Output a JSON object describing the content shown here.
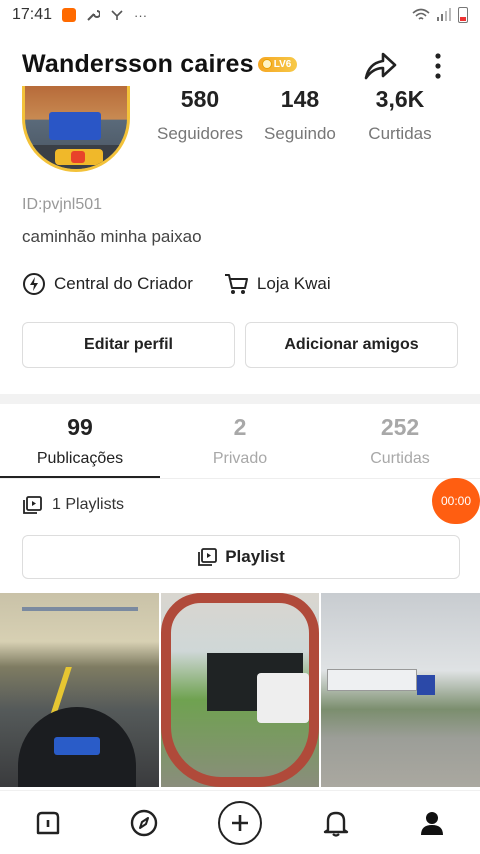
{
  "status_bar": {
    "time": "17:41",
    "dots": "···"
  },
  "profile": {
    "username": "Wandersson  caires",
    "level": "LV6",
    "user_id": "ID:pvjnl501",
    "bio": "caminhão minha paixao"
  },
  "stats": [
    {
      "value": "580",
      "label": "Seguidores"
    },
    {
      "value": "148",
      "label": "Seguindo"
    },
    {
      "value": "3,6K",
      "label": "Curtidas"
    }
  ],
  "links": {
    "creator": "Central do Criador",
    "shop": "Loja Kwai"
  },
  "buttons": {
    "edit": "Editar perfil",
    "add_friends": "Adicionar amigos"
  },
  "tabs": [
    {
      "count": "99",
      "label": "Publicações"
    },
    {
      "count": "2",
      "label": "Privado"
    },
    {
      "count": "252",
      "label": "Curtidas"
    }
  ],
  "playlists": {
    "count_label": "1 Playlists",
    "button": "Playlist"
  },
  "timer": "00:00",
  "colors": {
    "accent": "#ff5e11",
    "badge": "#f5a623"
  },
  "icons": {
    "share": "share-arrow-icon",
    "more": "more-vertical-icon",
    "creator": "lightning-circle-icon",
    "shop": "cart-icon",
    "playlist": "playlist-icon",
    "home": "home-icon",
    "discover": "compass-icon",
    "create": "plus-circle-icon",
    "notifications": "bell-icon",
    "profile": "person-icon"
  }
}
